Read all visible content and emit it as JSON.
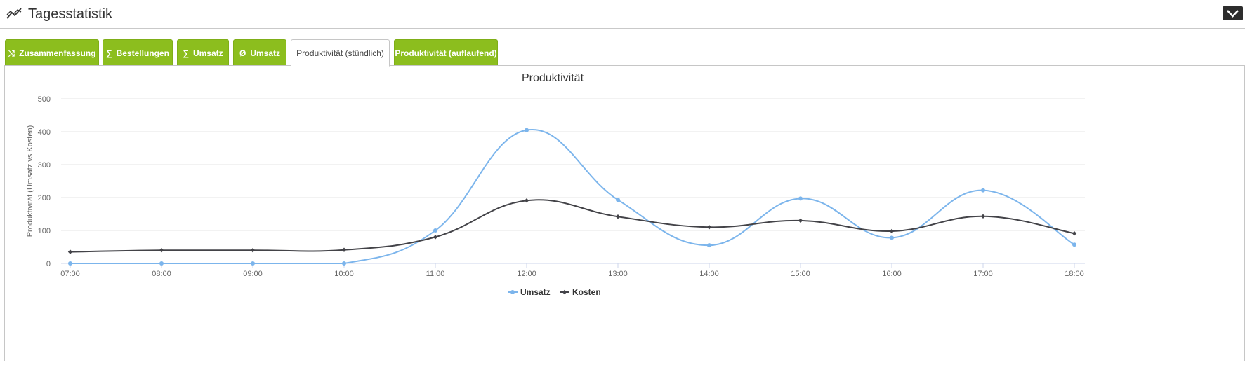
{
  "header": {
    "title": "Tagesstatistik"
  },
  "tabs": [
    {
      "glyph": "⤨",
      "label": "Zusammenfassung",
      "active": false
    },
    {
      "glyph": "∑",
      "label": "Bestellungen",
      "active": false
    },
    {
      "glyph": "∑",
      "label": "Umsatz",
      "active": false
    },
    {
      "glyph": "Ø",
      "label": "Umsatz",
      "active": false
    },
    {
      "glyph": "",
      "label": "Produktivität (stündlich)",
      "active": true
    },
    {
      "glyph": "",
      "label": "Produktivität (auflaufend)",
      "active": false
    }
  ],
  "colors": {
    "tab_green": "#8cbe1e",
    "series_umsatz": "#7cb5ec",
    "series_kosten": "#434348"
  },
  "chart_data": {
    "type": "line",
    "title": "Produktivität",
    "xlabel": "",
    "ylabel": "Produktivität (Umsatz vs Kosten)",
    "categories": [
      "07:00",
      "08:00",
      "09:00",
      "10:00",
      "11:00",
      "12:00",
      "13:00",
      "14:00",
      "15:00",
      "16:00",
      "17:00",
      "18:00"
    ],
    "ylim": [
      0,
      500
    ],
    "yticks": [
      "0",
      "100",
      "200",
      "300",
      "400",
      "500"
    ],
    "grid": true,
    "smooth": true,
    "legend_position": "bottom",
    "series": [
      {
        "name": "Umsatz",
        "color": "#7cb5ec",
        "marker": "circle",
        "values": [
          0,
          0,
          0,
          0,
          100,
          405,
          193,
          55,
          197,
          78,
          222,
          57
        ]
      },
      {
        "name": "Kosten",
        "color": "#434348",
        "marker": "diamond",
        "values": [
          35,
          40,
          40,
          41,
          80,
          191,
          142,
          110,
          130,
          98,
          143,
          91
        ]
      }
    ]
  }
}
